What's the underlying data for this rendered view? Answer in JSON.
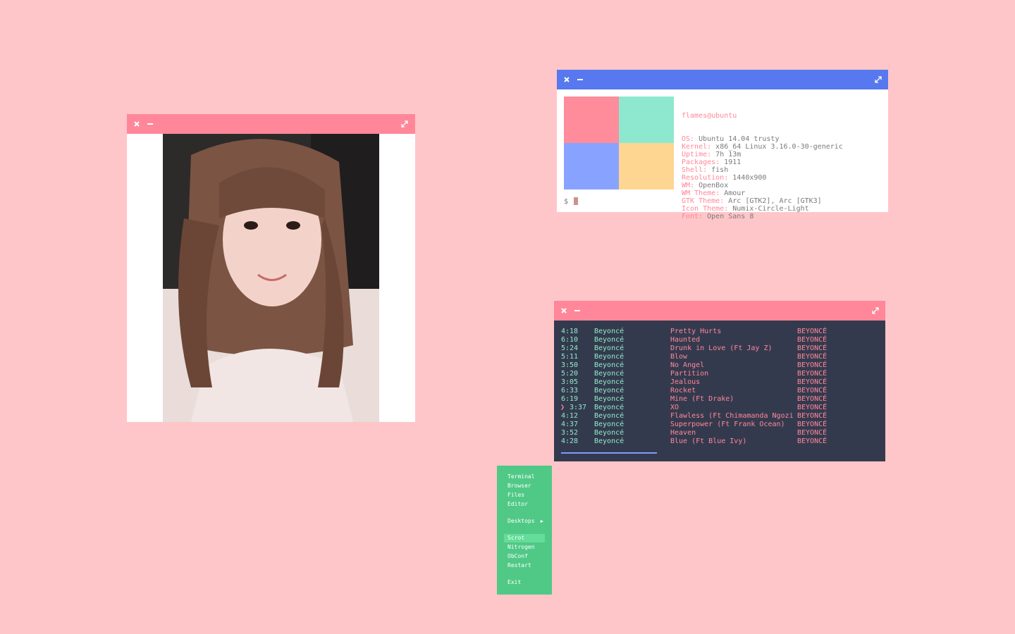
{
  "viewer": {
    "close_icon": "close-icon",
    "minimize_icon": "minimize-icon",
    "maximize_icon": "maximize-icon",
    "titlebar_color": "#ff8799"
  },
  "fetch": {
    "titlebar_color": "#5778ee",
    "swatches": [
      "#ff8c9b",
      "#8ee8cf",
      "#88a3ff",
      "#ffd592"
    ],
    "user_host": "flames@ubuntu",
    "lines": [
      {
        "key": "OS:",
        "value": " Ubuntu 14.04 trusty"
      },
      {
        "key": "Kernel:",
        "value": " x86_64 Linux 3.16.0-30-generic"
      },
      {
        "key": "Uptime:",
        "value": " 7h 13m"
      },
      {
        "key": "Packages:",
        "value": " 1911"
      },
      {
        "key": "Shell:",
        "value": " fish"
      },
      {
        "key": "Resolution:",
        "value": " 1440x900"
      },
      {
        "key": "WM:",
        "value": " OpenBox"
      },
      {
        "key": "WM Theme:",
        "value": " Amour"
      },
      {
        "key": "GTK Theme:",
        "value": " Arc [GTK2], Arc [GTK3]"
      },
      {
        "key": "Icon Theme:",
        "value": " Numix-Circle-Light"
      },
      {
        "key": "Font:",
        "value": " Open Sans 8"
      }
    ],
    "prompt": "$"
  },
  "music": {
    "titlebar_color": "#ff8799",
    "playing_marker": "❯",
    "tracks": [
      {
        "dur": "4:18",
        "artist": "Beyoncé",
        "title": "Pretty Hurts",
        "album": "BEYONCÉ"
      },
      {
        "dur": "6:10",
        "artist": "Beyoncé",
        "title": "Haunted",
        "album": "BEYONCÉ"
      },
      {
        "dur": "5:24",
        "artist": "Beyoncé",
        "title": "Drunk in Love (Ft Jay Z)",
        "album": "BEYONCÉ"
      },
      {
        "dur": "5:11",
        "artist": "Beyoncé",
        "title": "Blow",
        "album": "BEYONCÉ"
      },
      {
        "dur": "3:50",
        "artist": "Beyoncé",
        "title": "No Angel",
        "album": "BEYONCÉ"
      },
      {
        "dur": "5:20",
        "artist": "Beyoncé",
        "title": "Partition",
        "album": "BEYONCÉ"
      },
      {
        "dur": "3:05",
        "artist": "Beyoncé",
        "title": "Jealous",
        "album": "BEYONCÉ"
      },
      {
        "dur": "6:33",
        "artist": "Beyoncé",
        "title": "Rocket",
        "album": "BEYONCÉ"
      },
      {
        "dur": "6:19",
        "artist": "Beyoncé",
        "title": "Mine (Ft Drake)",
        "album": "BEYONCÉ"
      },
      {
        "dur": "3:37",
        "artist": "Beyoncé",
        "title": "XO",
        "album": "BEYONCÉ",
        "playing": true
      },
      {
        "dur": "4:12",
        "artist": "Beyoncé",
        "title": "Flawless (Ft Chimamanda Ngozi",
        "album": "BEYONCÉ"
      },
      {
        "dur": "4:37",
        "artist": "Beyoncé",
        "title": "Superpower (Ft Frank Ocean)",
        "album": "BEYONCÉ"
      },
      {
        "dur": "3:52",
        "artist": "Beyoncé",
        "title": "Heaven",
        "album": "BEYONCÉ"
      },
      {
        "dur": "4:28",
        "artist": "Beyoncé",
        "title": "Blue (Ft Blue Ivy)",
        "album": "BEYONCÉ"
      }
    ],
    "progress": 0.54
  },
  "menu": {
    "background": "#50c986",
    "items": [
      {
        "label": "Terminal"
      },
      {
        "label": "Browser"
      },
      {
        "label": "Files"
      },
      {
        "label": "Editor"
      },
      {
        "label": "Desktops",
        "submenu": true
      },
      {
        "label": "Scrot",
        "selected": true
      },
      {
        "label": "Nitrogen"
      },
      {
        "label": "ObConf"
      },
      {
        "label": "Restart"
      },
      {
        "label": "Exit"
      }
    ],
    "submenu_arrow": "▶"
  }
}
